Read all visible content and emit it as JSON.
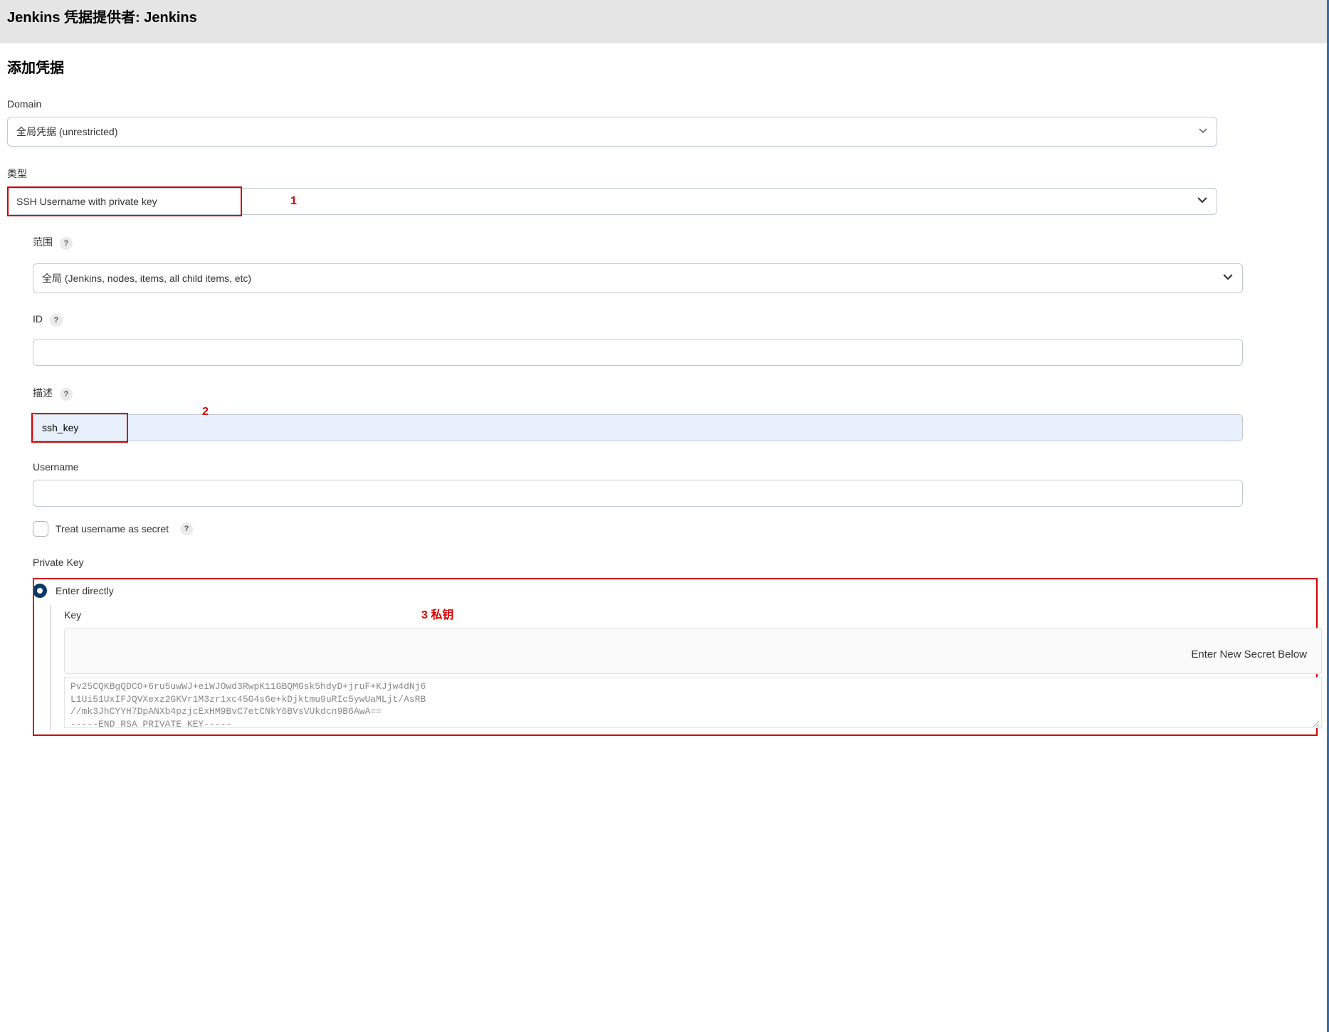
{
  "header": {
    "title": "Jenkins 凭据提供者: Jenkins"
  },
  "section_title": "添加凭据",
  "domain": {
    "label": "Domain",
    "value": "全局凭据 (unrestricted)"
  },
  "type": {
    "label": "类型",
    "value": "SSH Username with private key",
    "annotation": "1"
  },
  "scope": {
    "label": "范围",
    "value": "全局 (Jenkins, nodes, items, all child items, etc)"
  },
  "id": {
    "label": "ID",
    "value": ""
  },
  "description": {
    "label": "描述",
    "value": "ssh_key",
    "annotation": "2"
  },
  "username": {
    "label": "Username",
    "value": ""
  },
  "treat_username_secret": {
    "label": "Treat username as secret"
  },
  "private_key": {
    "label": "Private Key",
    "option": "Enter directly",
    "key_label": "Key",
    "annotation": "3 私钥",
    "secret_prompt": "Enter New Secret Below",
    "key_value": "Pv25CQKBgQDCO+6ru5uwWJ+eiWJOwd3RwpK11GBQMGsk5hdyD+jruF+KJjw4dNj6\nL1Ui51UxIFJQVXexz2GKVr1M3zr1xc45G4s6e+kDjktmu9uRIc5ywUaMLjt/AsRB\n//mk3JhCYYH7DpANXb4pzjcExHM9BvC7etCNkY6BVsVUkdcn9B6AwA==\n-----END RSA PRIVATE KEY-----"
  }
}
